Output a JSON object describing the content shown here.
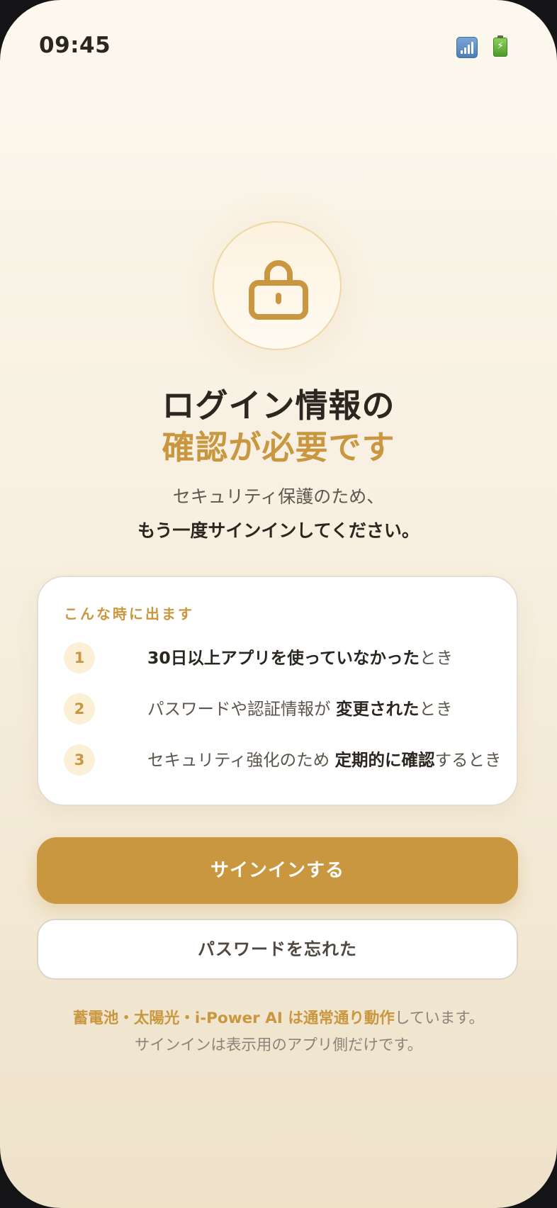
{
  "status_bar": {
    "time": "09:45",
    "signal_icon": "signal-icon",
    "battery_icon": "battery-icon",
    "bolt_glyph": "⚡"
  },
  "lock_icon": "lock-icon",
  "title": {
    "line1": "ログイン情報の",
    "line2": "確認が必要です"
  },
  "subtitle": {
    "line1": "セキュリティ保護のため、",
    "line2": "もう一度サインインしてください。"
  },
  "info_card": {
    "heading": "こんな時に出ます",
    "items": [
      {
        "number": "1",
        "strong": "30日以上アプリを使っていなかった",
        "suffix": "とき"
      },
      {
        "number": "2",
        "prefix": "パスワードや認証情報が ",
        "strong": "変更された",
        "suffix": "とき"
      },
      {
        "number": "3",
        "prefix": "セキュリティ強化のため ",
        "strong": "定期的に確認",
        "suffix": "するとき"
      }
    ]
  },
  "buttons": {
    "sign_in": "サインインする",
    "forgot_password": "パスワードを忘れた"
  },
  "footer": {
    "line1_accent": "蓄電池・太陽光・i-Power AI は通常通り動作",
    "line1_rest": "しています。",
    "line2": "サインインは表示用のアプリ側だけです。"
  },
  "colors": {
    "accent": "#c9973f",
    "text_dark": "#2b2620",
    "text_muted": "#8b847a",
    "badge_bg": "#fbefd6"
  }
}
